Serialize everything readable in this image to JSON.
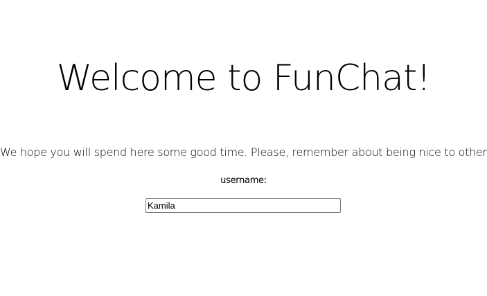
{
  "header": {
    "title": "Welcome to FunChat!"
  },
  "intro": {
    "text": "We hope you will spend here some good time. Please, remember about being nice to others."
  },
  "login": {
    "username_label": "username:",
    "username_value": "Kamila"
  }
}
